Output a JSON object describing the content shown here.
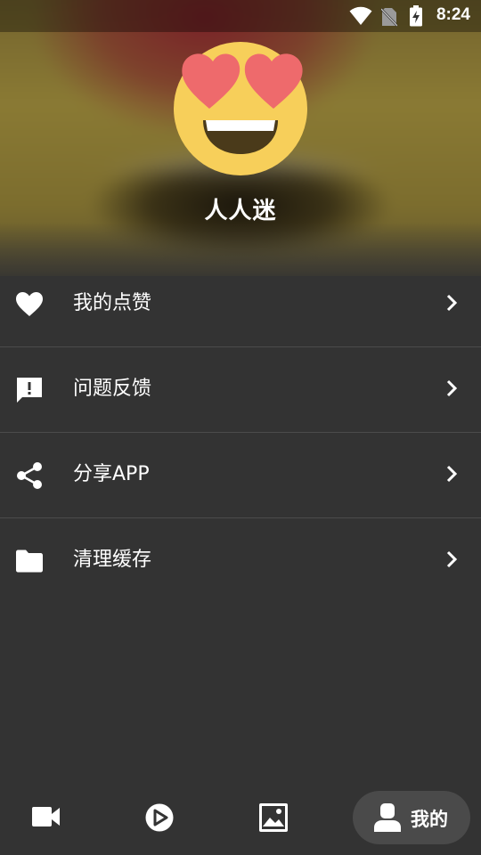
{
  "status_bar": {
    "time": "8:24",
    "icons": [
      "wifi-icon",
      "no-sim-icon",
      "battery-charging-icon"
    ]
  },
  "profile": {
    "avatar_icon": "heart-eyes-emoji-icon",
    "username": "人人迷"
  },
  "menu": {
    "items": [
      {
        "icon": "heart-icon",
        "label": "我的点赞"
      },
      {
        "icon": "feedback-icon",
        "label": "问题反馈"
      },
      {
        "icon": "share-icon",
        "label": "分享APP"
      },
      {
        "icon": "folder-icon",
        "label": "清理缓存"
      }
    ]
  },
  "bottom_nav": {
    "tabs": [
      {
        "icon": "video-camera-icon"
      },
      {
        "icon": "play-circle-icon"
      },
      {
        "icon": "image-icon"
      },
      {
        "icon": "person-icon",
        "label": "我的",
        "active": true
      }
    ]
  },
  "colors": {
    "background": "#333333",
    "divider": "#4b4b4b",
    "active_tab": "#4a4a4a",
    "text": "#ffffff"
  }
}
